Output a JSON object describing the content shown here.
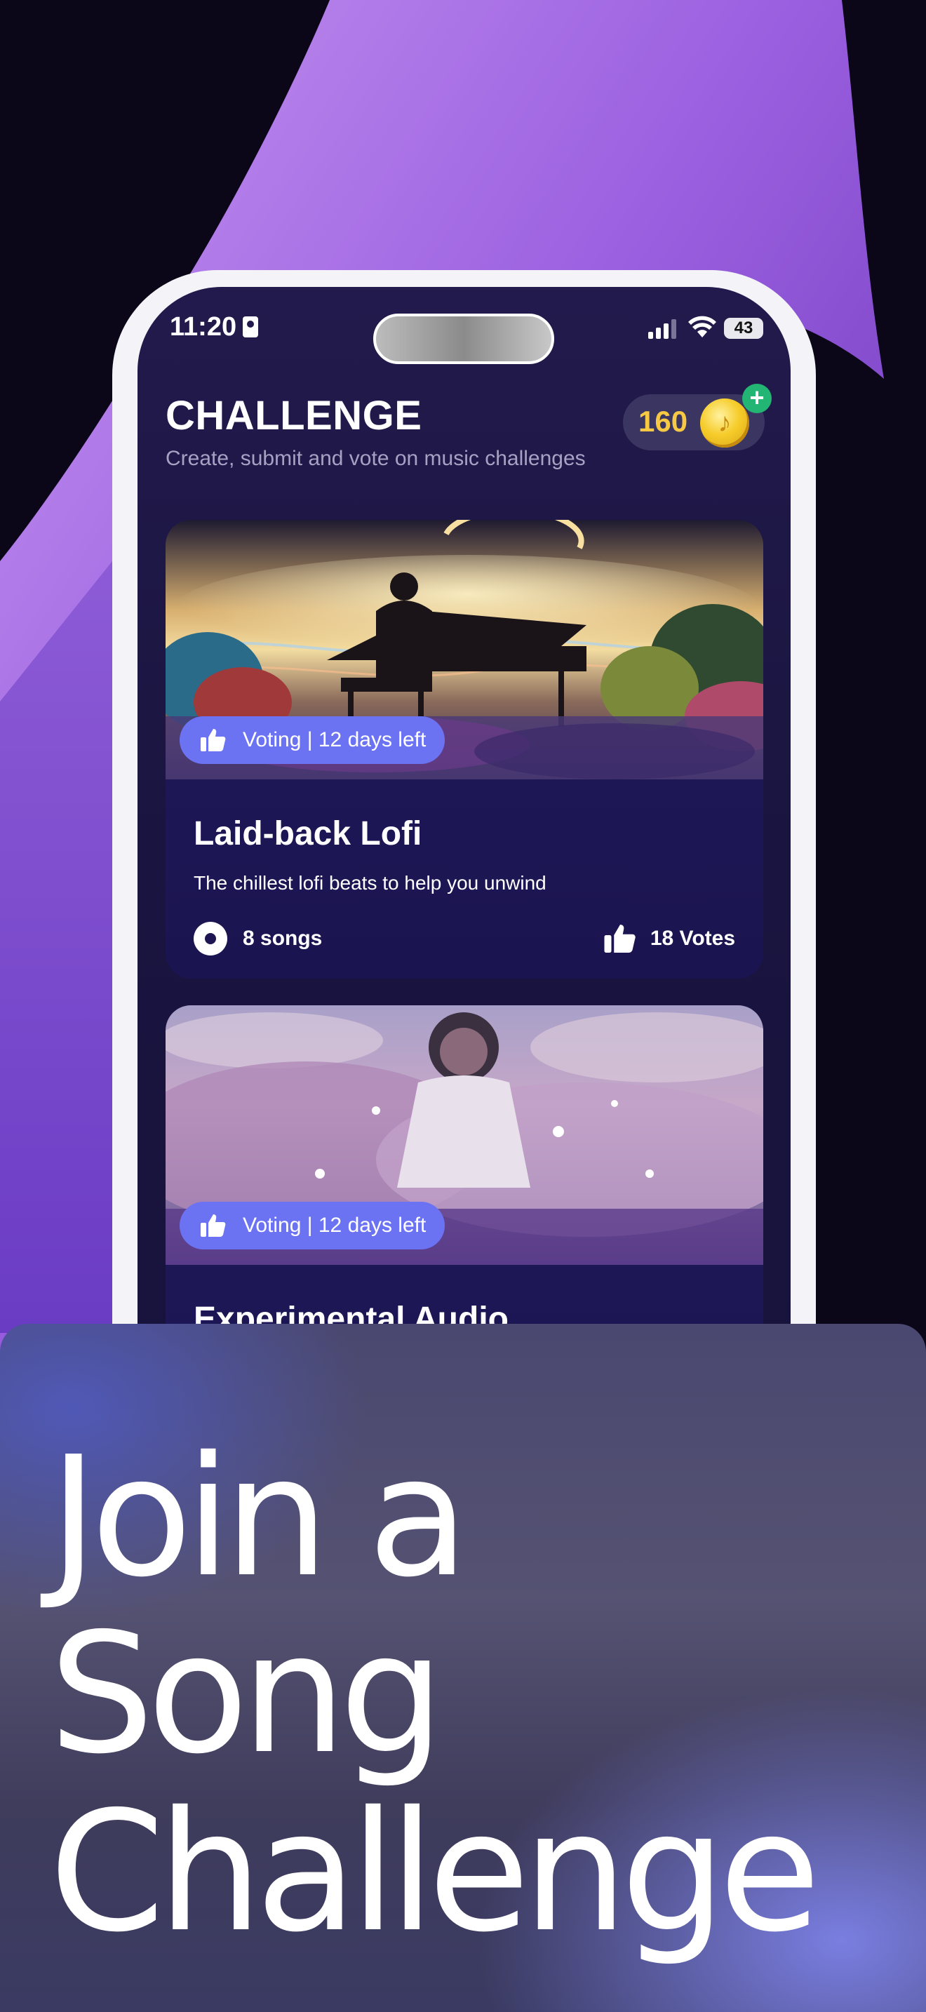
{
  "status_bar": {
    "time": "11:20",
    "battery": "43"
  },
  "header": {
    "title": "CHALLENGE",
    "subtitle": "Create, submit and vote on music challenges",
    "coins": "160"
  },
  "cards": [
    {
      "status": "Voting | 12 days left",
      "title": "Laid-back Lofi",
      "description": "The chillest lofi beats to help you unwind",
      "songs": "8 songs",
      "votes": "18 Votes"
    },
    {
      "status": "Voting | 12 days left",
      "title": "Experimental Audio"
    }
  ],
  "promo": {
    "line1": "Join a",
    "line2": "Song",
    "line3": "Challenge"
  },
  "colors": {
    "accent_pill": "#6b73f3",
    "coin_value": "#f7c843",
    "add_badge": "#22b573",
    "screen_bg": "#1a1540"
  },
  "icons": [
    "id-card-icon",
    "signal-icon",
    "wifi-icon",
    "battery-icon",
    "coin-icon",
    "plus-icon",
    "thumbs-up-icon",
    "disc-icon"
  ]
}
